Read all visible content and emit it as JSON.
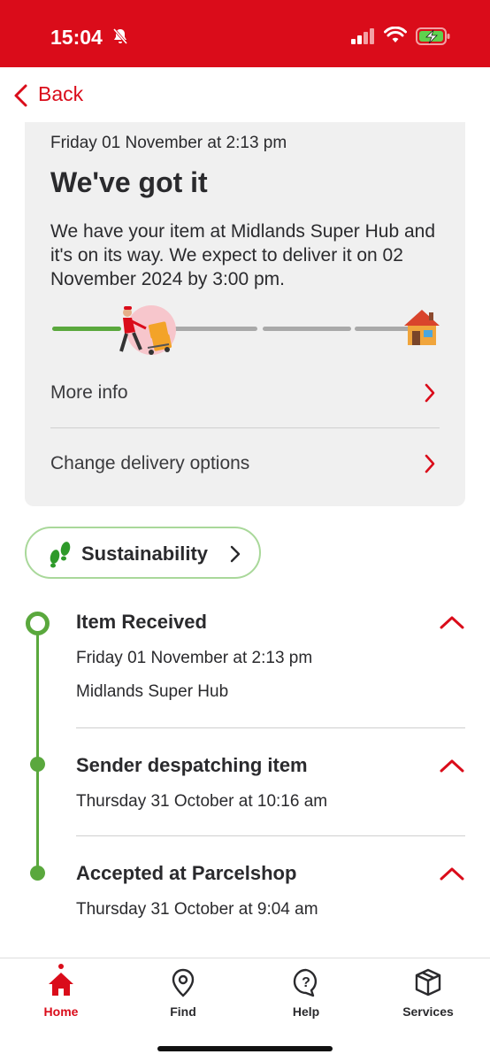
{
  "status_bar": {
    "time": "15:04",
    "background_color": "#da0c1a",
    "icons": [
      "bell-slash-icon",
      "signal-icon",
      "wifi-icon",
      "battery-charging-icon"
    ]
  },
  "nav": {
    "back_label": "Back",
    "accent_color": "#da0c1a"
  },
  "tracking_card": {
    "date": "Friday 01 November at 2:13 pm",
    "title": "We've got it",
    "description": "We have your item at Midlands Super Hub and it's on its way. We expect to deliver it on 02 November 2024 by 3:00 pm.",
    "progress_icons": [
      "courier-icon",
      "house-icon"
    ],
    "rows": [
      {
        "label": "More info"
      },
      {
        "label": "Change delivery options"
      }
    ]
  },
  "sustainability": {
    "label": "Sustainability",
    "icon": "footprints-icon"
  },
  "timeline": {
    "line_color": "#5aa83d",
    "events": [
      {
        "title": "Item Received",
        "lines": [
          "Friday 01 November at 2:13 pm",
          "Midlands Super Hub"
        ]
      },
      {
        "title": "Sender despatching item",
        "lines": [
          "Thursday 31 October at 10:16 am"
        ]
      },
      {
        "title": "Accepted at Parcelshop",
        "lines": [
          "Thursday 31 October at 9:04 am"
        ]
      }
    ]
  },
  "tab_bar": {
    "active": "Home",
    "tabs": [
      {
        "label": "Home",
        "icon": "home-icon"
      },
      {
        "label": "Find",
        "icon": "location-pin-icon"
      },
      {
        "label": "Help",
        "icon": "help-icon"
      },
      {
        "label": "Services",
        "icon": "box-icon"
      }
    ]
  }
}
